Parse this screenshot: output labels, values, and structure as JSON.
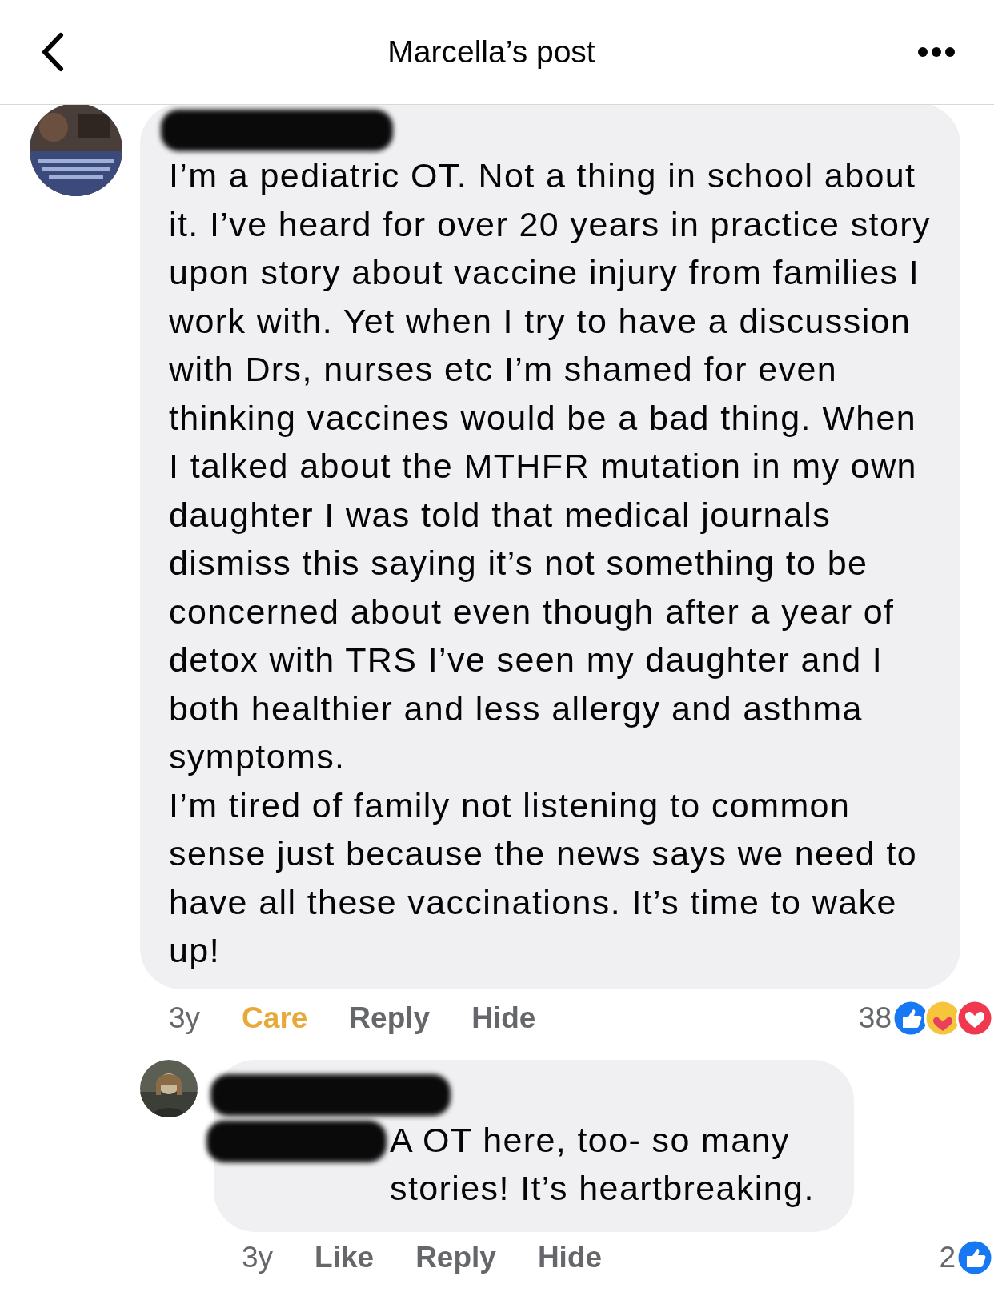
{
  "header": {
    "title": "Marcella’s post"
  },
  "comments": [
    {
      "kind": "comment",
      "name_redacted": true,
      "paragraphs": [
        "I’m a pediatric OT. Not a thing in school about it. I’ve heard for over 20 years in practice story upon story about vaccine injury from families I work with. Yet when I try to have a discussion with Drs, nurses etc I’m shamed for even thinking vaccines would be a bad thing. When I talked about the MTHFR mutation in my own daughter I was told that medical journals dismiss this saying it’s not something to be concerned about even though after a year of detox with TRS I’ve seen my daughter and I both healthier and less allergy and asthma symptoms.",
        "I’m tired of family not listening to common sense just because the news says we need to have all these vaccinations. It’s time to wake up!"
      ],
      "time": "3y",
      "reaction_label": "Care",
      "reacted": true,
      "actions": [
        "Reply",
        "Hide"
      ],
      "count": "38",
      "reactions": [
        {
          "kind": "like"
        },
        {
          "kind": "care"
        },
        {
          "kind": "love"
        }
      ]
    },
    {
      "kind": "reply",
      "name_redacted": true,
      "mention_redacted": true,
      "paragraphs": [
        "A OT here, too- so many stories! It’s heartbreaking."
      ],
      "time": "3y",
      "reaction_label": "Like",
      "reacted": false,
      "actions": [
        "Reply",
        "Hide"
      ],
      "count": "2",
      "reactions": [
        {
          "kind": "like"
        }
      ]
    }
  ]
}
